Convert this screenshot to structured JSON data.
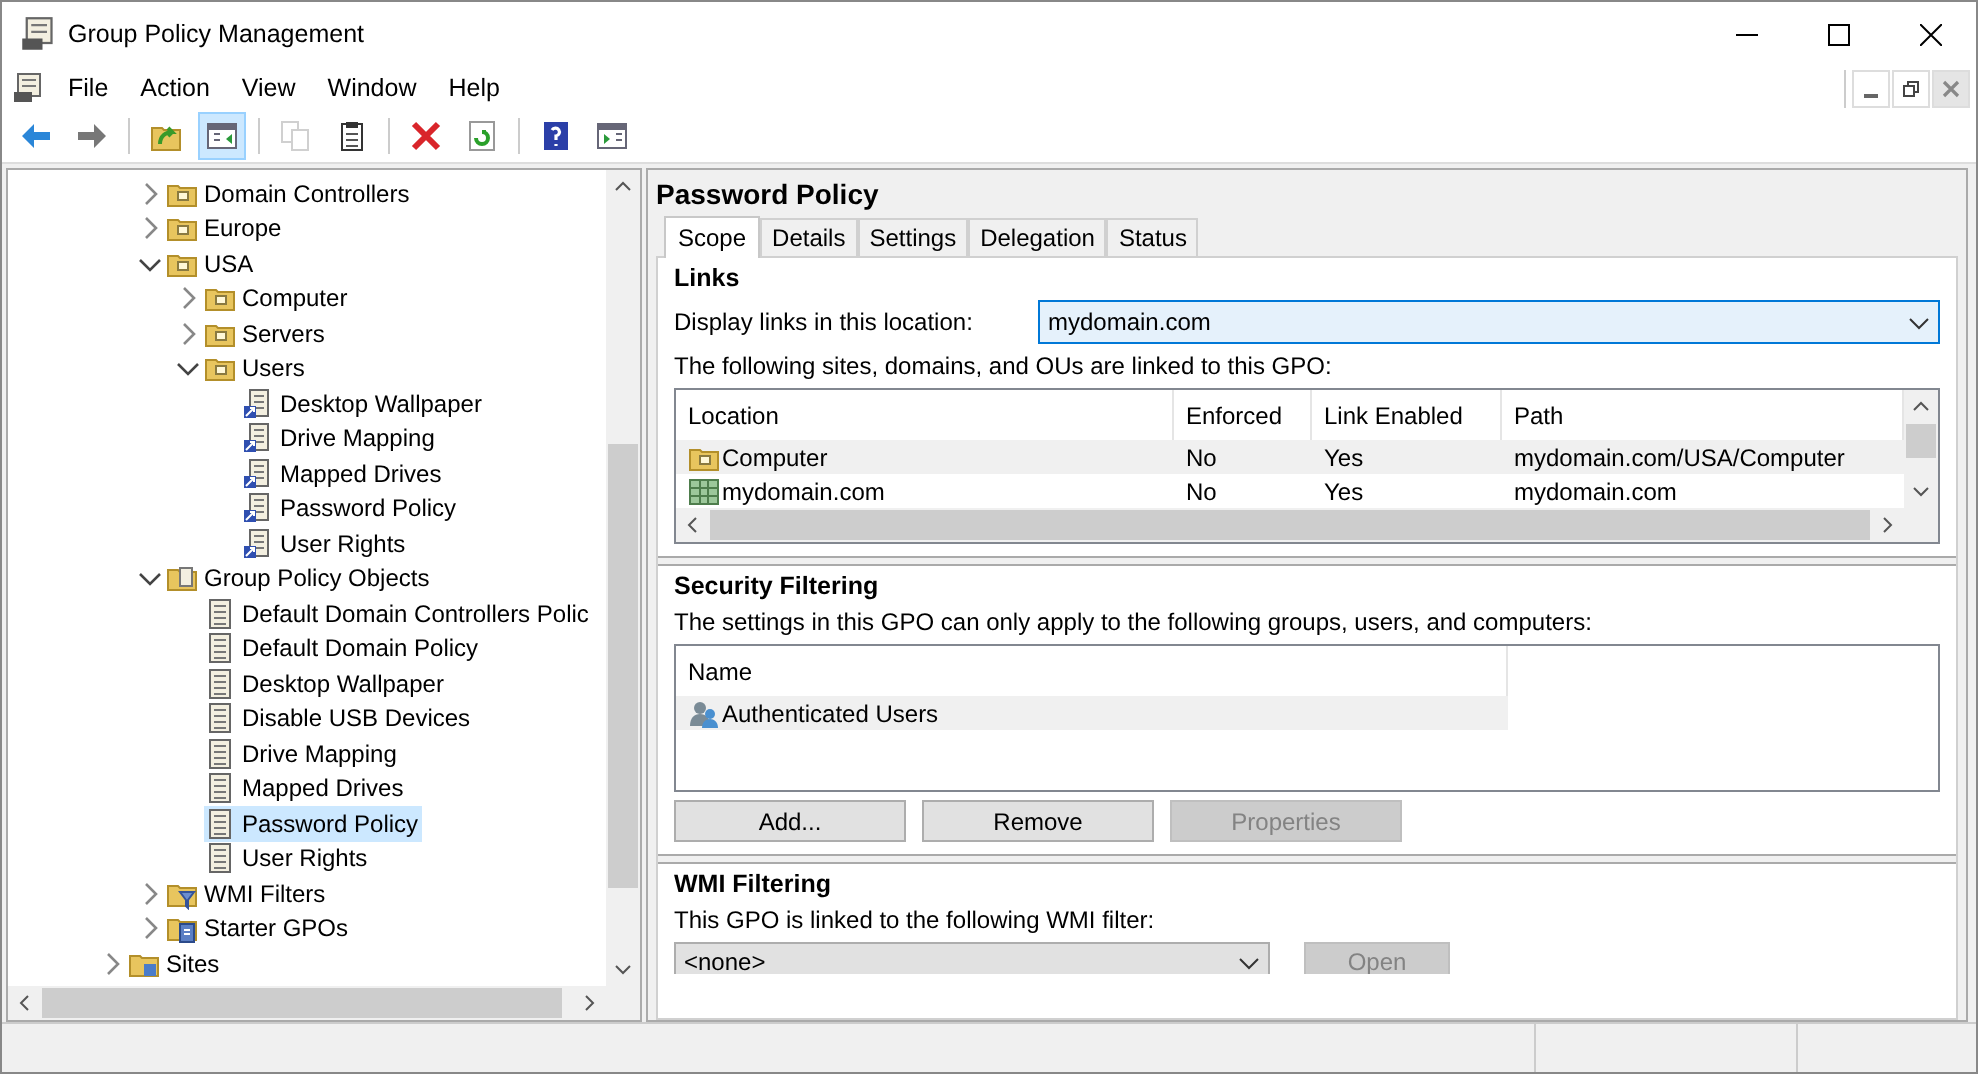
{
  "window": {
    "title": "Group Policy Management"
  },
  "menu": [
    "File",
    "Action",
    "View",
    "Window",
    "Help"
  ],
  "toolbar": [
    {
      "kind": "back",
      "disabled": false,
      "selected": false
    },
    {
      "kind": "forward",
      "disabled": false,
      "selected": false
    },
    {
      "kind": "sep"
    },
    {
      "kind": "up",
      "disabled": false,
      "selected": false
    },
    {
      "kind": "tree",
      "disabled": false,
      "selected": true
    },
    {
      "kind": "sep"
    },
    {
      "kind": "copy",
      "disabled": true,
      "selected": false
    },
    {
      "kind": "paste",
      "disabled": false,
      "selected": false
    },
    {
      "kind": "sep"
    },
    {
      "kind": "delete",
      "disabled": false,
      "selected": false
    },
    {
      "kind": "refresh",
      "disabled": false,
      "selected": false
    },
    {
      "kind": "sep"
    },
    {
      "kind": "help",
      "disabled": false,
      "selected": false
    },
    {
      "kind": "panel",
      "disabled": false,
      "selected": false
    }
  ],
  "tree": {
    "nodes": [
      {
        "label": "Domain Controllers",
        "kind": "ou",
        "expanded": false,
        "selected": false
      },
      {
        "label": "Europe",
        "kind": "ou",
        "expanded": false,
        "selected": false
      },
      {
        "label": "USA",
        "kind": "ou",
        "expanded": true,
        "selected": false,
        "children": [
          {
            "label": "Computer",
            "kind": "ou",
            "expanded": false,
            "selected": false
          },
          {
            "label": "Servers",
            "kind": "ou",
            "expanded": false,
            "selected": false
          },
          {
            "label": "Users",
            "kind": "ou",
            "expanded": true,
            "selected": false,
            "children": [
              {
                "label": "Desktop Wallpaper",
                "kind": "link",
                "selected": false
              },
              {
                "label": "Drive Mapping",
                "kind": "link",
                "selected": false
              },
              {
                "label": "Mapped Drives",
                "kind": "link",
                "selected": false
              },
              {
                "label": "Password Policy",
                "kind": "link",
                "selected": false
              },
              {
                "label": "User Rights",
                "kind": "link",
                "selected": false
              }
            ]
          }
        ]
      },
      {
        "label": "Group Policy Objects",
        "kind": "gpofolder",
        "expanded": true,
        "selected": false,
        "children": [
          {
            "label": "Default Domain Controllers Polic",
            "kind": "gpo",
            "selected": false
          },
          {
            "label": "Default Domain Policy",
            "kind": "gpo",
            "selected": false
          },
          {
            "label": "Desktop Wallpaper",
            "kind": "gpo",
            "selected": false
          },
          {
            "label": "Disable USB Devices",
            "kind": "gpo",
            "selected": false
          },
          {
            "label": "Drive Mapping",
            "kind": "gpo",
            "selected": false
          },
          {
            "label": "Mapped Drives",
            "kind": "gpo",
            "selected": false
          },
          {
            "label": "Password Policy",
            "kind": "gpo",
            "selected": true
          },
          {
            "label": "User Rights",
            "kind": "gpo",
            "selected": false
          }
        ]
      },
      {
        "label": "WMI Filters",
        "kind": "wmi",
        "expanded": false,
        "selected": false
      },
      {
        "label": "Starter GPOs",
        "kind": "starter",
        "expanded": false,
        "selected": false
      }
    ],
    "tail": [
      {
        "label": "Sites",
        "kind": "sites",
        "expanded": false,
        "selected": false
      }
    ]
  },
  "details": {
    "title": "Password Policy",
    "tabs": [
      {
        "label": "Scope",
        "selected": true
      },
      {
        "label": "Details",
        "selected": false
      },
      {
        "label": "Settings",
        "selected": false
      },
      {
        "label": "Delegation",
        "selected": false
      },
      {
        "label": "Status",
        "selected": false
      }
    ],
    "links": {
      "heading": "Links",
      "location_label": "Display links in this location:",
      "location_value": "mydomain.com",
      "description": "The following sites, domains, and OUs are linked to this GPO:",
      "columns": [
        "Location",
        "Enforced",
        "Link Enabled",
        "Path"
      ],
      "rows": [
        {
          "kind": "ou",
          "cells": [
            "Computer",
            "No",
            "Yes",
            "mydomain.com/USA/Computer"
          ],
          "selected": true
        },
        {
          "kind": "domain",
          "cells": [
            "mydomain.com",
            "No",
            "Yes",
            "mydomain.com"
          ],
          "selected": false
        }
      ]
    },
    "security": {
      "heading": "Security Filtering",
      "description": "The settings in this GPO can only apply to the following groups, users, and computers:",
      "columns": [
        "Name"
      ],
      "rows": [
        {
          "name": "Authenticated Users",
          "selected": true
        }
      ],
      "buttons": [
        {
          "label": "Add...",
          "disabled": false
        },
        {
          "label": "Remove",
          "disabled": false
        },
        {
          "label": "Properties",
          "disabled": true
        }
      ]
    },
    "wmi": {
      "heading": "WMI Filtering",
      "description": "This GPO is linked to the following WMI filter:",
      "filter_value": "<none>",
      "button": {
        "label": "Open",
        "disabled": true
      }
    }
  }
}
